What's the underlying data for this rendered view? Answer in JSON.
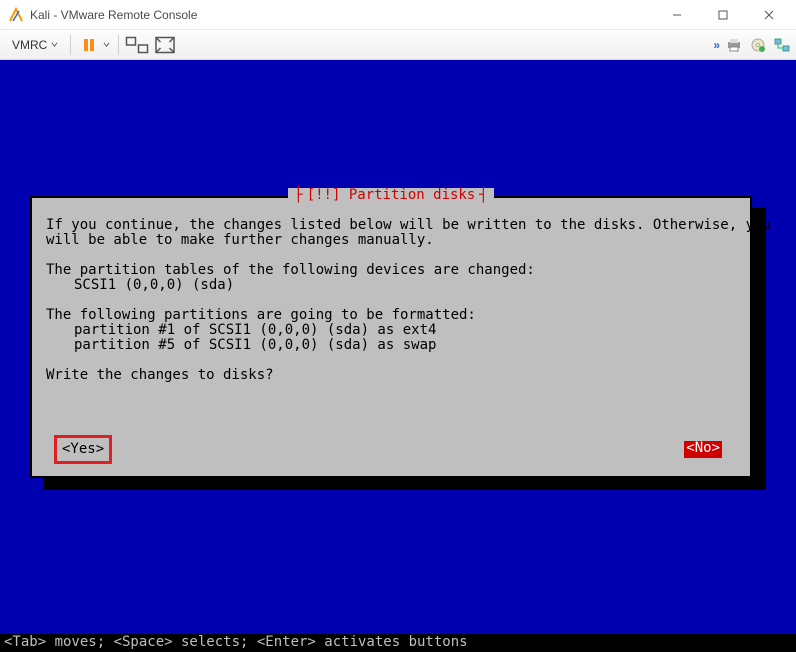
{
  "window": {
    "title": "Kali - VMware Remote Console"
  },
  "toolbar": {
    "vmrc_label": "VMRC"
  },
  "dialog": {
    "title": "[!!] Partition disks",
    "intro_l1": "If you continue, the changes listed below will be written to the disks. Otherwise, you",
    "intro_l2": "will be able to make further changes manually.",
    "tables_heading": "The partition tables of the following devices are changed:",
    "tables_item1": "SCSI1 (0,0,0) (sda)",
    "format_heading": "The following partitions are going to be formatted:",
    "format_item1": "partition #1 of SCSI1 (0,0,0) (sda) as ext4",
    "format_item2": "partition #5 of SCSI1 (0,0,0) (sda) as swap",
    "question": "Write the changes to disks?",
    "yes": "<Yes>",
    "no": "<No>"
  },
  "help": "<Tab> moves; <Space> selects; <Enter> activates buttons"
}
